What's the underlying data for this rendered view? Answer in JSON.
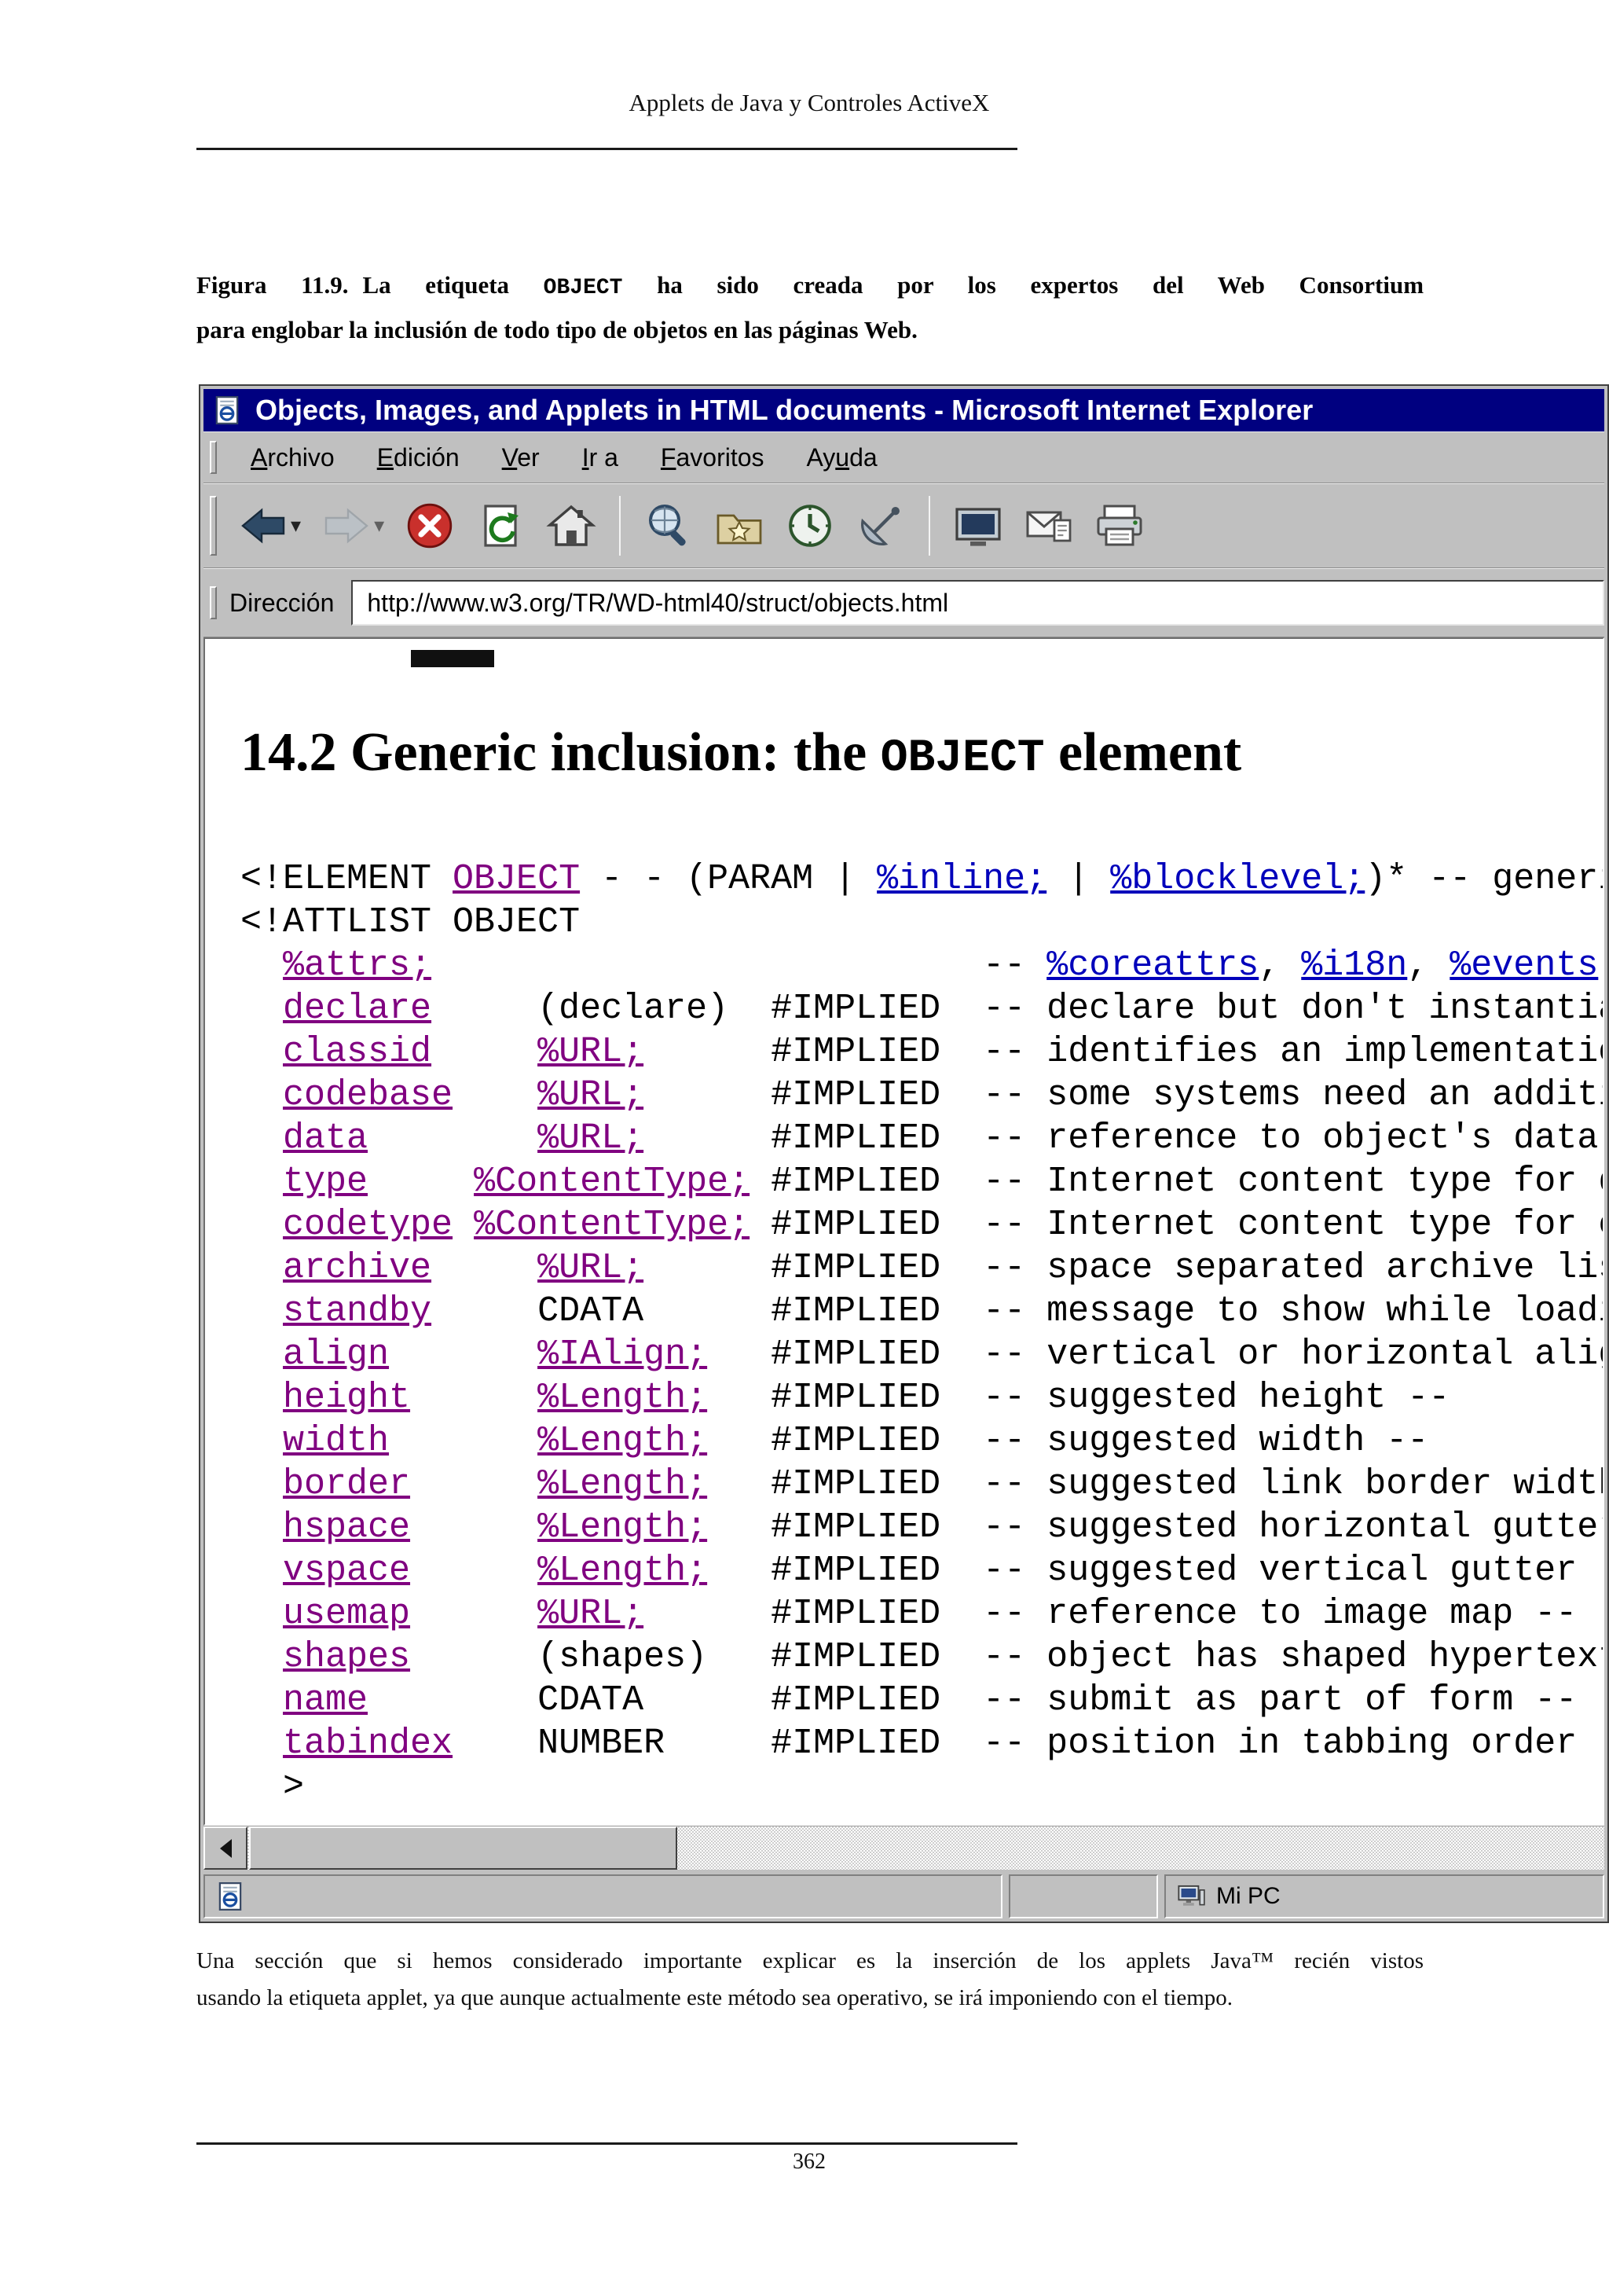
{
  "colors": {
    "titlebar": "#000080",
    "chrome": "#c0c0c0",
    "link": "#0000bb",
    "visited_link": "#800080"
  },
  "page": {
    "running_header": "Applets de Java y Controles ActiveX",
    "figure_caption": {
      "label": "Figura 11.9.",
      "line1_before_code": "La etiqueta",
      "code": "OBJECT",
      "line1_after_code": "ha sido creada por los expertos del Web Consortium",
      "line2": "para englobar la inclusión de todo tipo de objetos en las páginas Web."
    },
    "body_lines": [
      "Una sección que si hemos considerado importante explicar es la inserción de los applets Java™ recién vistos",
      "usando la etiqueta applet, ya que aunque actualmente este método sea operativo, se irá imponiendo con el tiempo."
    ],
    "page_number": "362"
  },
  "browser": {
    "window_title": "Objects, Images, and Applets in HTML documents - Microsoft Internet Explorer",
    "menu_items": [
      {
        "label": "Archivo",
        "accel_index": 0
      },
      {
        "label": "Edición",
        "accel_index": 0
      },
      {
        "label": "Ver",
        "accel_index": 0
      },
      {
        "label": "Ir a",
        "accel_index": 0
      },
      {
        "label": "Favoritos",
        "accel_index": 0
      },
      {
        "label": "Ayuda",
        "accel_index": 2
      }
    ],
    "toolbar_buttons": [
      {
        "name": "back",
        "icon": "back-arrow",
        "has_dropdown": true,
        "disabled": false
      },
      {
        "name": "forward",
        "icon": "forward-arrow",
        "has_dropdown": true,
        "disabled": true
      },
      {
        "name": "stop",
        "icon": "stop"
      },
      {
        "name": "refresh",
        "icon": "refresh"
      },
      {
        "name": "home",
        "icon": "home"
      },
      {
        "name": "separator"
      },
      {
        "name": "search",
        "icon": "search"
      },
      {
        "name": "favorites",
        "icon": "favorites"
      },
      {
        "name": "history",
        "icon": "history"
      },
      {
        "name": "channels",
        "icon": "channels"
      },
      {
        "name": "separator"
      },
      {
        "name": "fullscreen",
        "icon": "fullscreen"
      },
      {
        "name": "mail",
        "icon": "mail"
      },
      {
        "name": "print",
        "icon": "print"
      }
    ],
    "address": {
      "label": "Dirección",
      "value": "http://www.w3.org/TR/WD-html40/struct/objects.html"
    },
    "status_bar": {
      "zone_label": "Mi PC"
    },
    "content": {
      "heading": {
        "before": "14.2 Generic inclusion: the ",
        "code": "OBJECT",
        "after": " element"
      },
      "dtd_lines": [
        [
          {
            "t": "<!ELEMENT ",
            "s": "p"
          },
          {
            "t": "OBJECT",
            "s": "v"
          },
          {
            "t": " - - (PARAM | ",
            "s": "p"
          },
          {
            "t": "%inline;",
            "s": "b"
          },
          {
            "t": " | ",
            "s": "p"
          },
          {
            "t": "%blocklevel;",
            "s": "b"
          },
          {
            "t": ")* -- generic embedded object -->",
            "s": "p"
          }
        ],
        [
          {
            "t": "<!ATTLIST OBJECT",
            "s": "p"
          }
        ],
        [
          {
            "t": "  ",
            "s": "p"
          },
          {
            "t": "%attrs;",
            "s": "v"
          },
          {
            "t": "                          -- ",
            "s": "p"
          },
          {
            "t": "%coreattrs",
            "s": "b"
          },
          {
            "t": ", ",
            "s": "p"
          },
          {
            "t": "%i18n",
            "s": "b"
          },
          {
            "t": ", ",
            "s": "p"
          },
          {
            "t": "%events",
            "s": "b"
          },
          {
            "t": " --",
            "s": "p"
          }
        ],
        [
          {
            "t": "  ",
            "s": "p"
          },
          {
            "t": "declare",
            "s": "v"
          },
          {
            "t": "     (declare)  #IMPLIED  -- declare but don't instantiate flag --",
            "s": "p"
          }
        ],
        [
          {
            "t": "  ",
            "s": "p"
          },
          {
            "t": "classid",
            "s": "v"
          },
          {
            "t": "     ",
            "s": "p"
          },
          {
            "t": "%URL;",
            "s": "v"
          },
          {
            "t": "      #IMPLIED  -- identifies an implementation --",
            "s": "p"
          }
        ],
        [
          {
            "t": "  ",
            "s": "p"
          },
          {
            "t": "codebase",
            "s": "v"
          },
          {
            "t": "    ",
            "s": "p"
          },
          {
            "t": "%URL;",
            "s": "v"
          },
          {
            "t": "      #IMPLIED  -- some systems need an additional URL --",
            "s": "p"
          }
        ],
        [
          {
            "t": "  ",
            "s": "p"
          },
          {
            "t": "data",
            "s": "v"
          },
          {
            "t": "        ",
            "s": "p"
          },
          {
            "t": "%URL;",
            "s": "v"
          },
          {
            "t": "      #IMPLIED  -- reference to object's data --",
            "s": "p"
          }
        ],
        [
          {
            "t": "  ",
            "s": "p"
          },
          {
            "t": "type",
            "s": "v"
          },
          {
            "t": "     ",
            "s": "p"
          },
          {
            "t": "%ContentType;",
            "s": "v"
          },
          {
            "t": " #IMPLIED  -- Internet content type for data --",
            "s": "p"
          }
        ],
        [
          {
            "t": "  ",
            "s": "p"
          },
          {
            "t": "codetype",
            "s": "v"
          },
          {
            "t": " ",
            "s": "p"
          },
          {
            "t": "%ContentType;",
            "s": "v"
          },
          {
            "t": " #IMPLIED  -- Internet content type for code --",
            "s": "p"
          }
        ],
        [
          {
            "t": "  ",
            "s": "p"
          },
          {
            "t": "archive",
            "s": "v"
          },
          {
            "t": "     ",
            "s": "p"
          },
          {
            "t": "%URL;",
            "s": "v"
          },
          {
            "t": "      #IMPLIED  -- space separated archive list --",
            "s": "p"
          }
        ],
        [
          {
            "t": "  ",
            "s": "p"
          },
          {
            "t": "standby",
            "s": "v"
          },
          {
            "t": "     CDATA      #IMPLIED  -- message to show while loading --",
            "s": "p"
          }
        ],
        [
          {
            "t": "  ",
            "s": "p"
          },
          {
            "t": "align",
            "s": "v"
          },
          {
            "t": "       ",
            "s": "p"
          },
          {
            "t": "%IAlign;",
            "s": "v"
          },
          {
            "t": "   #IMPLIED  -- vertical or horizontal alignment --",
            "s": "p"
          }
        ],
        [
          {
            "t": "  ",
            "s": "p"
          },
          {
            "t": "height",
            "s": "v"
          },
          {
            "t": "      ",
            "s": "p"
          },
          {
            "t": "%Length;",
            "s": "v"
          },
          {
            "t": "   #IMPLIED  -- suggested height --",
            "s": "p"
          }
        ],
        [
          {
            "t": "  ",
            "s": "p"
          },
          {
            "t": "width",
            "s": "v"
          },
          {
            "t": "       ",
            "s": "p"
          },
          {
            "t": "%Length;",
            "s": "v"
          },
          {
            "t": "   #IMPLIED  -- suggested width --",
            "s": "p"
          }
        ],
        [
          {
            "t": "  ",
            "s": "p"
          },
          {
            "t": "border",
            "s": "v"
          },
          {
            "t": "      ",
            "s": "p"
          },
          {
            "t": "%Length;",
            "s": "v"
          },
          {
            "t": "   #IMPLIED  -- suggested link border width --",
            "s": "p"
          }
        ],
        [
          {
            "t": "  ",
            "s": "p"
          },
          {
            "t": "hspace",
            "s": "v"
          },
          {
            "t": "      ",
            "s": "p"
          },
          {
            "t": "%Length;",
            "s": "v"
          },
          {
            "t": "   #IMPLIED  -- suggested horizontal gutter --",
            "s": "p"
          }
        ],
        [
          {
            "t": "  ",
            "s": "p"
          },
          {
            "t": "vspace",
            "s": "v"
          },
          {
            "t": "      ",
            "s": "p"
          },
          {
            "t": "%Length;",
            "s": "v"
          },
          {
            "t": "   #IMPLIED  -- suggested vertical gutter --",
            "s": "p"
          }
        ],
        [
          {
            "t": "  ",
            "s": "p"
          },
          {
            "t": "usemap",
            "s": "v"
          },
          {
            "t": "      ",
            "s": "p"
          },
          {
            "t": "%URL;",
            "s": "v"
          },
          {
            "t": "      #IMPLIED  -- reference to image map --",
            "s": "p"
          }
        ],
        [
          {
            "t": "  ",
            "s": "p"
          },
          {
            "t": "shapes",
            "s": "v"
          },
          {
            "t": "      (shapes)   #IMPLIED  -- object has shaped hypertext links --",
            "s": "p"
          }
        ],
        [
          {
            "t": "  ",
            "s": "p"
          },
          {
            "t": "name",
            "s": "v"
          },
          {
            "t": "        CDATA      #IMPLIED  -- submit as part of form --",
            "s": "p"
          }
        ],
        [
          {
            "t": "  ",
            "s": "p"
          },
          {
            "t": "tabindex",
            "s": "v"
          },
          {
            "t": "    NUMBER     #IMPLIED  -- position in tabbing order --",
            "s": "p"
          }
        ],
        [
          {
            "t": "  >",
            "s": "p"
          }
        ]
      ]
    }
  }
}
